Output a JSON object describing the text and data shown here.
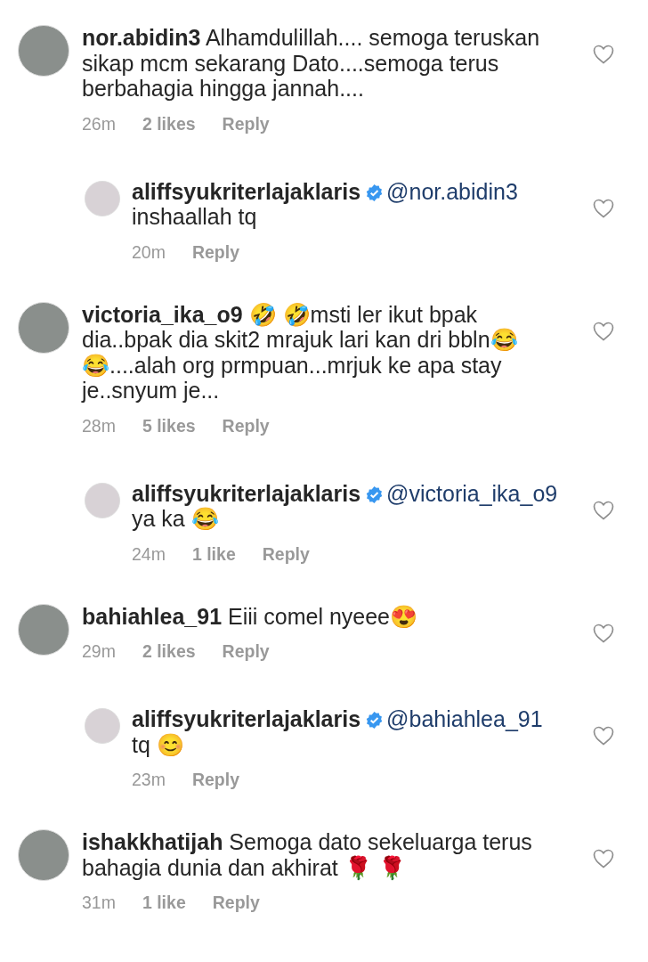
{
  "comments": [
    {
      "kind": "comment",
      "username": "nor.abidin3",
      "verified": false,
      "text": " Alhamdulillah.... semoga teruskan sikap mcm sekarang Dato....semoga terus berbahagia hingga jannah....",
      "time": "26m",
      "likes": "2 likes",
      "reply": "Reply",
      "liked": false
    },
    {
      "kind": "reply",
      "username": "aliffsyukriterlajaklaris",
      "verified": true,
      "mention": "@nor.abidin3",
      "text": "inshaallah tq",
      "time": "20m",
      "reply": "Reply",
      "liked": false
    },
    {
      "kind": "comment",
      "username": "victoria_ika_o9",
      "verified": false,
      "text": " 🤣 🤣msti ler ikut bpak dia..bpak dia skit2 mrajuk lari kan dri bbln😂 😂....alah org prmpuan...mrjuk ke apa stay je..snyum je...",
      "time": "28m",
      "likes": "5 likes",
      "reply": "Reply",
      "liked": false
    },
    {
      "kind": "reply",
      "username": "aliffsyukriterlajaklaris",
      "verified": true,
      "mention": "@victoria_ika_o9",
      "text": "ya ka 😂",
      "time": "24m",
      "likes": "1 like",
      "reply": "Reply",
      "liked": false
    },
    {
      "kind": "comment",
      "username": "bahiahlea_91",
      "verified": false,
      "text": " Eiii comel nyeee😍",
      "time": "29m",
      "likes": "2 likes",
      "reply": "Reply",
      "liked": false
    },
    {
      "kind": "reply",
      "username": "aliffsyukriterlajaklaris",
      "verified": true,
      "mention": "@bahiahlea_91",
      "text": "tq 😊",
      "time": "23m",
      "reply": "Reply",
      "liked": false
    },
    {
      "kind": "comment",
      "username": "ishakkhatijah",
      "verified": false,
      "text": " Semoga dato sekeluarga terus bahagia dunia dan akhirat 🌹 🌹",
      "time": "31m",
      "likes": "1 like",
      "reply": "Reply",
      "liked": false
    }
  ]
}
